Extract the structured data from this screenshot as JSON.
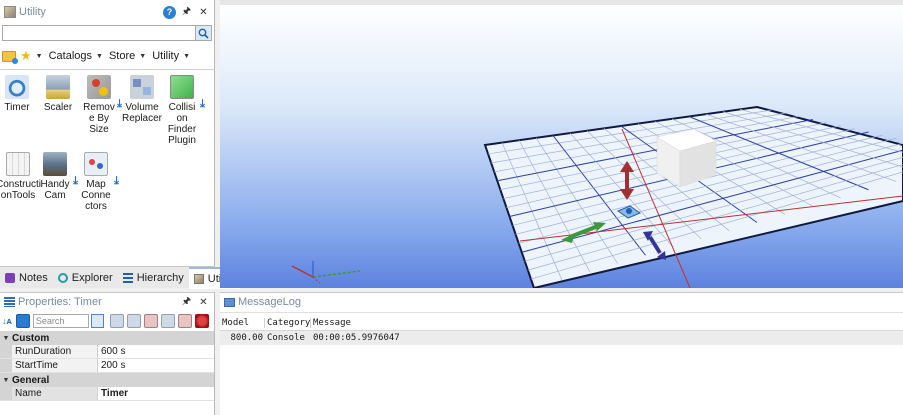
{
  "utility_panel": {
    "title": "Utility",
    "search_value": "",
    "nav": {
      "catalogs": "Catalogs",
      "store": "Store",
      "utility": "Utility"
    },
    "tools": [
      {
        "label": "Timer",
        "icon": "timer-icon",
        "download": false
      },
      {
        "label": "Scaler",
        "icon": "scaler-icon",
        "download": false
      },
      {
        "label": "Remove By Size",
        "icon": "remove-by-size-icon",
        "download": true
      },
      {
        "label": "Volume Replacer",
        "icon": "volume-replacer-icon",
        "download": false
      },
      {
        "label": "Collision Finder Plugin",
        "icon": "collision-finder-icon",
        "download": true
      },
      {
        "label": "ConstructionTools",
        "icon": "construction-tools-icon",
        "download": false
      },
      {
        "label": "Handy Cam",
        "icon": "handy-cam-icon",
        "download": true
      },
      {
        "label": "Map Connectors",
        "icon": "map-connectors-icon",
        "download": true
      }
    ],
    "tool_labels": {
      "timer": "Timer",
      "scaler": "Scaler",
      "remove_1": "Remov",
      "remove_2": "e By",
      "remove_3": "Size",
      "volume_1": "Volume",
      "volume_2": "Replacer",
      "collision_1": "Collisi",
      "collision_2": "on",
      "collision_3": "Finder",
      "collision_4": "Plugin",
      "construct_1": "Constructi",
      "construct_2": "onTools",
      "handy_1": "Handy",
      "handy_2": "Cam",
      "map_1": "Map",
      "map_2": "Conne",
      "map_3": "ctors"
    },
    "tabs": {
      "notes": "Notes",
      "explorer": "Explorer",
      "hierarchy": "Hierarchy",
      "utility": "Utility"
    }
  },
  "properties": {
    "title": "Properties: Timer",
    "search_placeholder": "Search",
    "categories": [
      {
        "name": "Custom",
        "rows": [
          {
            "name": "RunDuration",
            "value": "600 s"
          },
          {
            "name": "StartTime",
            "value": "200 s"
          }
        ]
      },
      {
        "name": "General",
        "rows": [
          {
            "name": "Name",
            "value": "Timer"
          }
        ]
      }
    ]
  },
  "message_log": {
    "title": "MessageLog",
    "columns": {
      "model": "Model",
      "category": "Category",
      "message": "Message"
    },
    "rows": [
      {
        "model": "800.00",
        "category": "Console",
        "message": "00:00:05.9976047"
      }
    ]
  },
  "colors": {
    "accent": "#2a7fd4",
    "sky_bottom": "#5c82de",
    "grid_line": "#2b3fa8",
    "axis_red": "#c03030"
  }
}
